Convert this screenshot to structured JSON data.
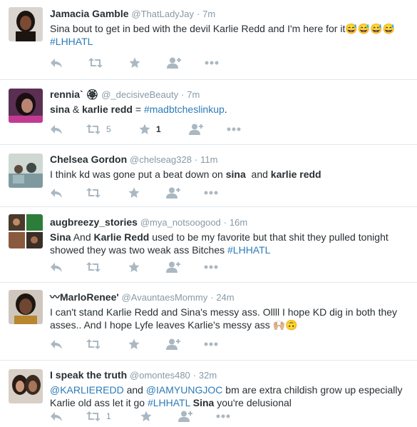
{
  "tweets": [
    {
      "name": "Jamacia Gamble",
      "handle": "@ThatLadyJay",
      "time": "7m",
      "text_segments": [
        {
          "t": "Sina bout to get in bed with the devil Karlie Redd and I'm here for it"
        },
        {
          "t": "😅😅😅😅"
        },
        {
          "t": " "
        },
        {
          "t": "#LHHATL",
          "k": "tag"
        }
      ],
      "retweets": "",
      "likes": ""
    },
    {
      "name": "rennia` 🏵",
      "handle": "@_decisiveBeauty",
      "time": "7m",
      "text_segments": [
        {
          "t": "sina",
          "k": "b"
        },
        {
          "t": " & "
        },
        {
          "t": "karlie redd",
          "k": "b"
        },
        {
          "t": " = "
        },
        {
          "t": "#madbtcheslinkup",
          "k": "tag"
        },
        {
          "t": "."
        }
      ],
      "retweets": "5",
      "likes": "1"
    },
    {
      "name": "Chelsea Gordon",
      "handle": "@chelseag328",
      "time": "11m",
      "text_segments": [
        {
          "t": "I think kd was gone put a beat down on "
        },
        {
          "t": "sina",
          "k": "b"
        },
        {
          "t": "  and "
        },
        {
          "t": "karlie redd",
          "k": "b"
        }
      ],
      "retweets": "",
      "likes": ""
    },
    {
      "name": "augbreezy_stories",
      "handle": "@mya_notsoogood",
      "time": "16m",
      "text_segments": [
        {
          "t": "Sina",
          "k": "b"
        },
        {
          "t": " And "
        },
        {
          "t": "Karlie Redd",
          "k": "b"
        },
        {
          "t": " used to be my favorite but that shit they pulled tonight showed they was two weak ass Bitches "
        },
        {
          "t": "#LHHATL",
          "k": "tag"
        }
      ],
      "retweets": "",
      "likes": ""
    },
    {
      "name": "〰MarloRenee'",
      "handle": "@AvauntaesMommy",
      "time": "24m",
      "text_segments": [
        {
          "t": "I can't stand Karlie Redd and Sina's messy ass. Ollll I hope KD dig in both they asses.. And I hope Lyfe leaves Karlie's messy ass 🙌🏼🙃"
        }
      ],
      "retweets": "",
      "likes": ""
    },
    {
      "name": "I speak the truth",
      "handle": "@omontes480",
      "time": "32m",
      "text_segments": [
        {
          "t": "@KARLIEREDD",
          "k": "tag"
        },
        {
          "t": " and "
        },
        {
          "t": "@IAMYUNGJOC",
          "k": "tag"
        },
        {
          "t": " bm are extra childish grow up especially Karlie old ass let it go "
        },
        {
          "t": "#LHHATL",
          "k": "tag"
        },
        {
          "t": " "
        },
        {
          "t": "Sina",
          "k": "b"
        },
        {
          "t": " you're delusional"
        }
      ],
      "retweets": "1",
      "likes": ""
    }
  ],
  "actions": {
    "reply_icon": "reply-icon",
    "retweet_icon": "retweet-icon",
    "like_icon": "star-icon",
    "follow_icon": "follow-icon",
    "more_icon": "more-icon"
  },
  "colors": {
    "link": "#2b7bb9",
    "muted": "#8899a6",
    "icon": "#aab8c2",
    "text": "#292f33",
    "divider": "#e1e8ed"
  }
}
